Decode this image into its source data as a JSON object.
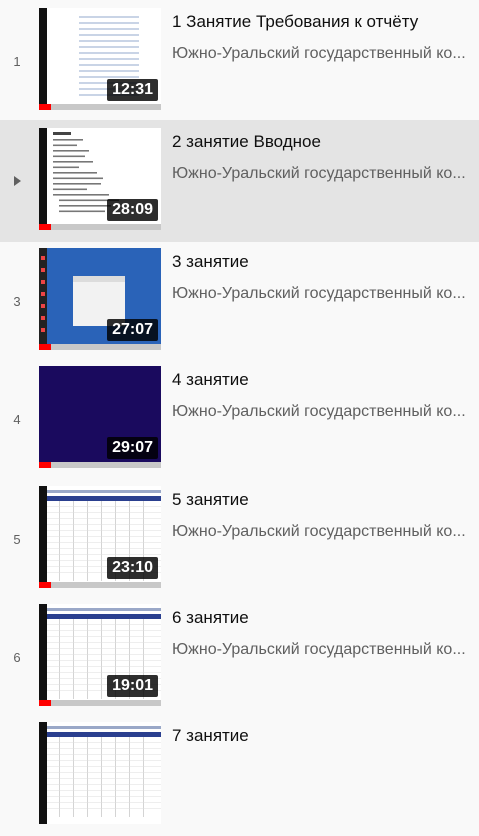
{
  "playlist": {
    "items": [
      {
        "index": "1",
        "title": "1 Занятие Требования к отчёту",
        "channel": "Южно-Уральский государственный ко...",
        "duration": "12:31",
        "progress": 0.1,
        "thumb": "doc-grid",
        "active": false
      },
      {
        "index": "",
        "title": "2 занятие Вводное",
        "channel": "Южно-Уральский государственный ко...",
        "duration": "28:09",
        "progress": 0.1,
        "thumb": "doc-list",
        "active": true
      },
      {
        "index": "3",
        "title": "3 занятие",
        "channel": "Южно-Уральский государственный ко...",
        "duration": "27:07",
        "progress": 0.1,
        "thumb": "desktop",
        "active": false
      },
      {
        "index": "4",
        "title": "4 занятие",
        "channel": "Южно-Уральский государственный ко...",
        "duration": "29:07",
        "progress": 0.1,
        "thumb": "navy",
        "active": false
      },
      {
        "index": "5",
        "title": "5 занятие",
        "channel": "Южно-Уральский государственный ко...",
        "duration": "23:10",
        "progress": 0.1,
        "thumb": "spreadsheet",
        "active": false
      },
      {
        "index": "6",
        "title": "6 занятие",
        "channel": "Южно-Уральский государственный ко...",
        "duration": "19:01",
        "progress": 0.1,
        "thumb": "spreadsheet",
        "active": false
      },
      {
        "index": "",
        "title": "7 занятие",
        "channel": "",
        "duration": "",
        "progress": 0,
        "thumb": "spreadsheet",
        "active": false
      }
    ]
  },
  "colors": {
    "progress_fill": "#ff0000",
    "active_row": "#e4e4e4",
    "desktop_blue": "#2a63b8",
    "navy": "#1a0a5e"
  },
  "icons": {
    "now_playing": "play-triangle-icon"
  }
}
